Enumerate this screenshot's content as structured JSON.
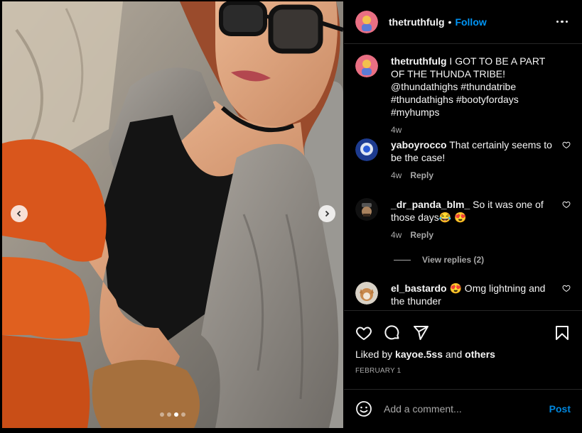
{
  "media": {
    "carousel_slides": 4,
    "active_slide": 3
  },
  "header": {
    "username": "thetruthfulg",
    "separator": "•",
    "follow_label": "Follow"
  },
  "caption": {
    "username": "thetruthfulg",
    "text": "I GOT TO BE A PART OF THE THUNDA TRIBE! @thundathighs #thundatribe #thundathighs #bootyfordays #myhumps",
    "time": "4w"
  },
  "comments": [
    {
      "username": "yaboyrocco",
      "text": "That certainly seems to be the case!",
      "time": "4w",
      "reply_label": "Reply"
    },
    {
      "username": "_dr_panda_blm_",
      "text": "So it was one of those days😂 😍",
      "time": "4w",
      "reply_label": "Reply"
    },
    {
      "username": "el_bastardo",
      "text": "😍 Omg lightning and the thunder"
    }
  ],
  "view_replies_label": "View replies (2)",
  "likes": {
    "prefix": "Liked by",
    "user": "kayoe.5ss",
    "middle": "and",
    "others": "others"
  },
  "date": "FEBRUARY 1",
  "add_comment": {
    "placeholder": "Add a comment...",
    "post_label": "Post"
  },
  "colors": {
    "accent": "#0095f6",
    "background": "#000000",
    "secondary_text": "#a8a8a8"
  },
  "icons": [
    "more-options-icon",
    "heart-icon",
    "comment-icon",
    "share-icon",
    "bookmark-icon",
    "emoji-icon",
    "chevron-left-icon",
    "chevron-right-icon"
  ]
}
